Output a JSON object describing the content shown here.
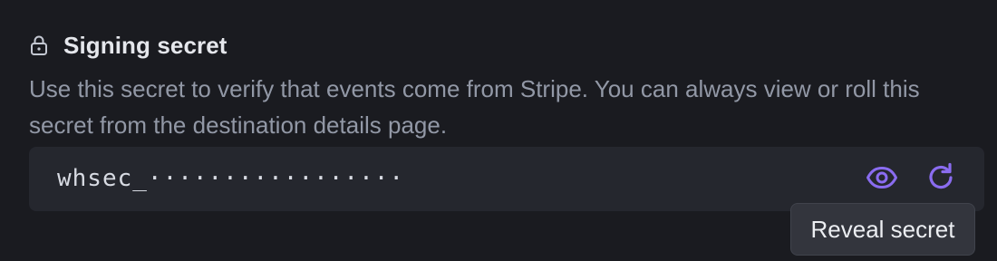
{
  "section": {
    "title": "Signing secret",
    "description": "Use this secret to verify that events come from Stripe. You can always view or roll this secret from the destination details page.",
    "icon": "lock-icon"
  },
  "secret": {
    "masked_value": "whsec_·················",
    "reveal_icon": "eye-icon",
    "roll_icon": "refresh-icon"
  },
  "tooltip": {
    "text": "Reveal secret"
  },
  "colors": {
    "background": "#1a1b20",
    "field_background": "#25272e",
    "accent": "#8a6cf0",
    "heading": "#e5e7ec",
    "muted_text": "#9298a6"
  }
}
